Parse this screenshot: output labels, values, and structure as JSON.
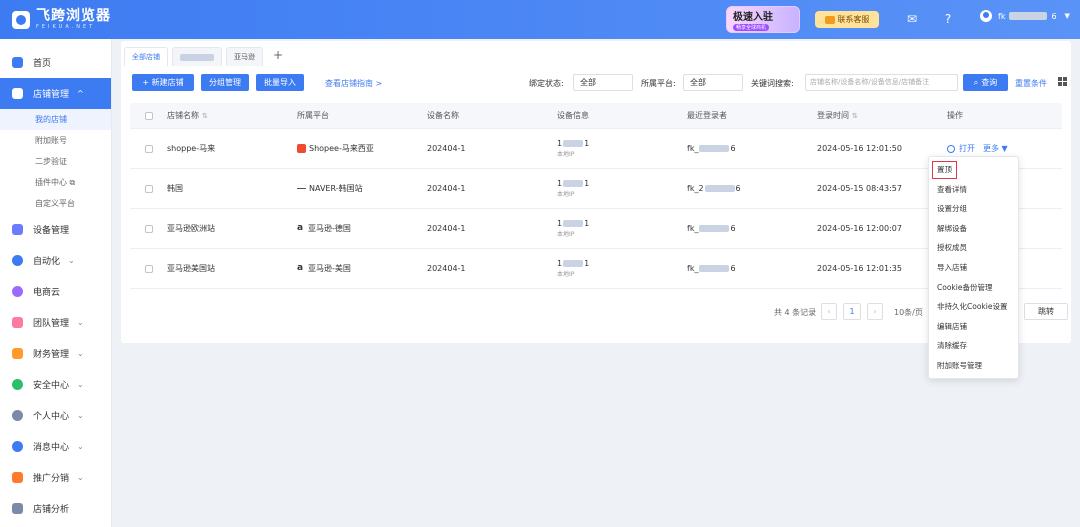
{
  "app": {
    "name": "飞跨浏览器",
    "subtitle": "FEIKUA.NET"
  },
  "header": {
    "promo_title": "极速入驻",
    "promo_sub": "畅享全球商机",
    "support_label": "联系客服",
    "user_prefix": "fk",
    "user_suffix": "6"
  },
  "sidebar": {
    "items": [
      {
        "label": "首页",
        "color": "#3d7bf2"
      },
      {
        "label": "店铺管理",
        "color": "#ffffff"
      },
      {
        "label": "设备管理",
        "color": "#6b7cff"
      },
      {
        "label": "自动化",
        "color": "#3d7bf2"
      },
      {
        "label": "电商云",
        "color": "#9b6bff"
      },
      {
        "label": "团队管理",
        "color": "#ff7aa0"
      },
      {
        "label": "财务管理",
        "color": "#ff9b2b"
      },
      {
        "label": "安全中心",
        "color": "#2bbf6a"
      },
      {
        "label": "个人中心",
        "color": "#7a8aa8"
      },
      {
        "label": "消息中心",
        "color": "#3d7bf2"
      },
      {
        "label": "推广分销",
        "color": "#ff7a2b"
      },
      {
        "label": "店铺分析",
        "color": "#7a8aa8"
      }
    ],
    "sub_items": [
      "我的店铺",
      "附加账号",
      "二步验证",
      "插件中心",
      "自定义平台"
    ]
  },
  "tabs": {
    "all": "全部店铺",
    "amazon": "亚马逊"
  },
  "toolbar": {
    "new_store": "+ 新建店铺",
    "group_manage": "分组管理",
    "batch_import": "批量导入",
    "guide_link": "查看店铺指南 >",
    "bind_status_label": "绑定状态:",
    "bind_status_value": "全部",
    "platform_label": "所属平台:",
    "platform_value": "全部",
    "keyword_label": "关键词搜索:",
    "keyword_placeholder": "店铺名称/设备名称/设备信息/店铺备注",
    "search_button": "查询",
    "reset_link": "重置条件"
  },
  "table": {
    "headers": [
      "店铺名称",
      "所属平台",
      "设备名称",
      "设备信息",
      "最近登录者",
      "登录时间",
      "操作"
    ],
    "rows": [
      {
        "name": "shoppe-马来",
        "platform": "Shopee-马来西亚",
        "device": "202404-1",
        "dev_a": "1",
        "dev_b": "1",
        "dev_sub": "本地IP",
        "login_a": "fk_",
        "login_b": "6",
        "time": "2024-05-16 12:01:50"
      },
      {
        "name": "韩国",
        "platform": "NAVER-韩国站",
        "device": "202404-1",
        "dev_a": "1",
        "dev_b": "1",
        "dev_sub": "本地IP",
        "login_a": "fk_2",
        "login_b": "6",
        "time": "2024-05-15 08:43:57"
      },
      {
        "name": "亚马逊欧洲站",
        "platform": "亚马逊-德国",
        "device": "202404-1",
        "dev_a": "1",
        "dev_b": "1",
        "dev_sub": "本地IP",
        "login_a": "fk_",
        "login_b": "6",
        "time": "2024-05-16 12:00:07"
      },
      {
        "name": "亚马逊美国站",
        "platform": "亚马逊-美国",
        "device": "202404-1",
        "dev_a": "1",
        "dev_b": "1",
        "dev_sub": "本地IP",
        "login_a": "fk_",
        "login_b": "6",
        "time": "2024-05-16 12:01:35"
      }
    ],
    "op_open": "打开",
    "op_more": "更多"
  },
  "pager": {
    "total": "共 4 条记录",
    "page": "1",
    "per_page": "10条/页",
    "jump": "跳转"
  },
  "menu": {
    "items": [
      "置顶",
      "查看详情",
      "设置分组",
      "解绑设备",
      "授权成员",
      "导入店铺",
      "Cookie备份管理",
      "非持久化Cookie设置",
      "编辑店铺",
      "清除缓存",
      "附加账号管理"
    ]
  }
}
